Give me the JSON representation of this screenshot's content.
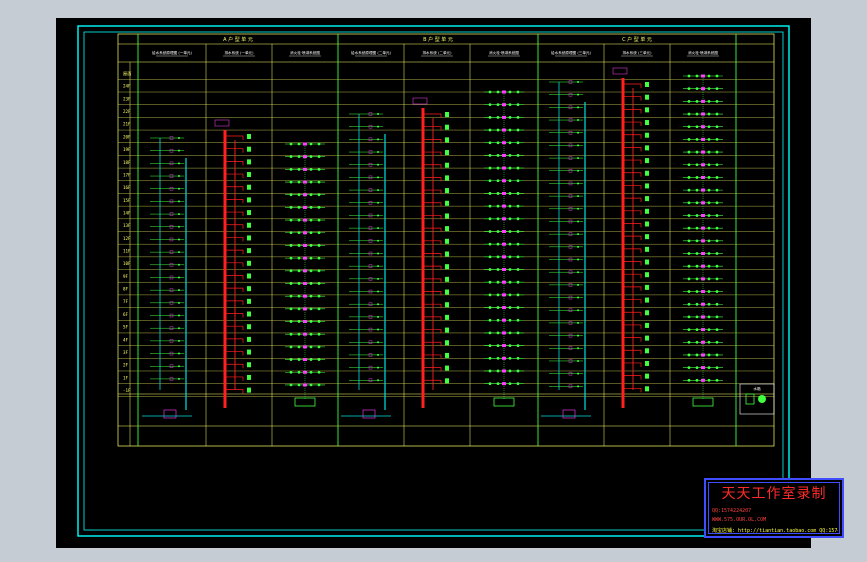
{
  "colors": {
    "background": "#c6ccd3",
    "sheet": "#000000",
    "frame": "#00ffff",
    "grid": "#ffff66",
    "riser_main": "#ff2020",
    "riser_secondary": "#00e0e0",
    "fixture": "#40ff40",
    "fixture_accent": "#ff40ff",
    "stamp_border": "#3f4dff",
    "stamp_text": "#ff2a2a"
  },
  "drawing": {
    "sections": [
      {
        "header": "A 户 型 单 元",
        "columns": [
          "给水系统原理图 (一单元)",
          "排水系统 (一单元)",
          "消火栓·喷淋系统图"
        ]
      },
      {
        "header": "B 户 型 单 元",
        "columns": [
          "给水系统原理图 (二单元)",
          "排水系统 (二单元)",
          "消火栓·喷淋系统图"
        ]
      },
      {
        "header": "C 户 型 单 元",
        "columns": [
          "给水系统原理图 (三单元)",
          "排水系统 (三单元)",
          "消火栓·喷淋系统图"
        ]
      }
    ],
    "floor_labels": [
      "屋面",
      "24F",
      "23F",
      "22F",
      "21F",
      "20F",
      "19F",
      "18F",
      "17F",
      "16F",
      "15F",
      "14F",
      "13F",
      "12F",
      "11F",
      "10F",
      "9F",
      "8F",
      "7F",
      "6F",
      "5F",
      "4F",
      "3F",
      "2F",
      "1F",
      "-1F"
    ],
    "equipment_legend": "水箱"
  },
  "stamp": {
    "title": "天天工作室录制",
    "qq": "QQ:1574224207",
    "website": "WWW.575.OUR.OL.COM",
    "shop": "淘宝店铺: http://tiantian.taobao.com  QQ:1574224207"
  }
}
